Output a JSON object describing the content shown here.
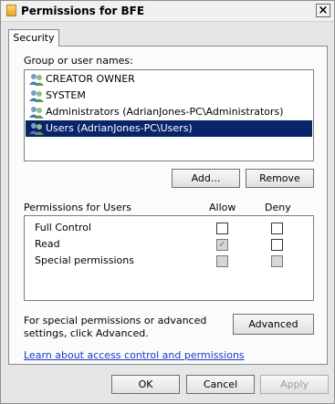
{
  "window": {
    "title": "Permissions for BFE"
  },
  "tabs": [
    {
      "label": "Security"
    }
  ],
  "groups": {
    "label": "Group or user names:",
    "items": [
      {
        "label": "CREATOR OWNER",
        "selected": false
      },
      {
        "label": "SYSTEM",
        "selected": false
      },
      {
        "label": "Administrators (AdrianJones-PC\\Administrators)",
        "selected": false
      },
      {
        "label": "Users (AdrianJones-PC\\Users)",
        "selected": true
      }
    ],
    "add_label": "Add...",
    "remove_label": "Remove"
  },
  "permissions": {
    "label": "Permissions for Users",
    "allow_header": "Allow",
    "deny_header": "Deny",
    "rows": [
      {
        "name": "Full Control",
        "allow": "unchecked",
        "deny": "unchecked"
      },
      {
        "name": "Read",
        "allow": "checked-disabled",
        "deny": "unchecked"
      },
      {
        "name": "Special permissions",
        "allow": "disabled",
        "deny": "disabled"
      }
    ]
  },
  "advanced": {
    "text": "For special permissions or advanced settings, click Advanced.",
    "button_label": "Advanced"
  },
  "help_link": "Learn about access control and permissions",
  "footer": {
    "ok_label": "OK",
    "cancel_label": "Cancel",
    "apply_label": "Apply"
  }
}
